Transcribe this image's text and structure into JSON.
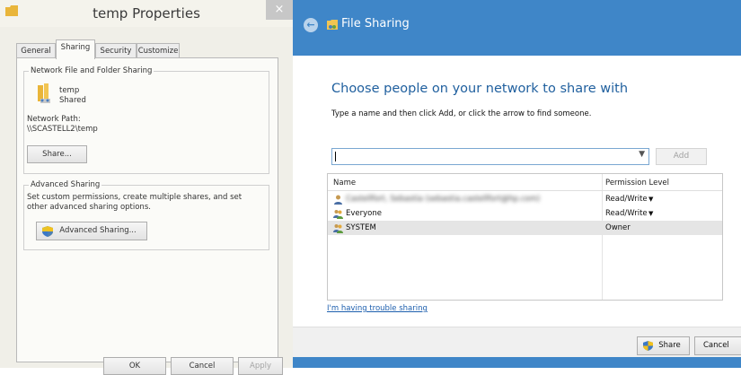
{
  "properties_window": {
    "title": "temp Properties",
    "close_label": "×",
    "tabs": [
      {
        "label": "General"
      },
      {
        "label": "Sharing",
        "active": true
      },
      {
        "label": "Security"
      },
      {
        "label": "Customize"
      }
    ],
    "network_sharing": {
      "legend": "Network File and Folder Sharing",
      "folder_name": "temp",
      "folder_status": "Shared",
      "network_path_label": "Network Path:",
      "network_path_value": "\\\\SCASTELL2\\temp",
      "share_button": "Share..."
    },
    "advanced_sharing": {
      "legend": "Advanced Sharing",
      "description": "Set custom permissions, create multiple shares, and set other advanced sharing options.",
      "button": "Advanced Sharing..."
    },
    "footer": {
      "ok": "OK",
      "cancel": "Cancel",
      "apply": "Apply"
    }
  },
  "file_sharing": {
    "title": "File Sharing",
    "back_icon": "back-arrow-icon",
    "heading": "Choose people on your network to share with",
    "instruction": "Type a name and then click Add, or click the arrow to find someone.",
    "input_value": "",
    "add_button": "Add",
    "columns": {
      "name": "Name",
      "permission": "Permission Level"
    },
    "rows": [
      {
        "name": "Castellfort, Sebastia (sebastia.castellfort@hp.com)",
        "permission": "Read/Write",
        "has_dropdown": true,
        "icon": "user-icon",
        "blurred": true
      },
      {
        "name": "Everyone",
        "permission": "Read/Write",
        "has_dropdown": true,
        "icon": "users-group-icon"
      },
      {
        "name": "SYSTEM",
        "permission": "Owner",
        "has_dropdown": false,
        "icon": "users-group-icon",
        "selected": true
      }
    ],
    "trouble_link": "I'm having trouble sharing",
    "share_button": "Share",
    "cancel_button": "Cancel"
  },
  "colors": {
    "titlebar_blue": "#3f86c8",
    "heading_blue": "#1f5f9e",
    "link_blue": "#1d5fae",
    "window_bg": "#f0efe8"
  }
}
